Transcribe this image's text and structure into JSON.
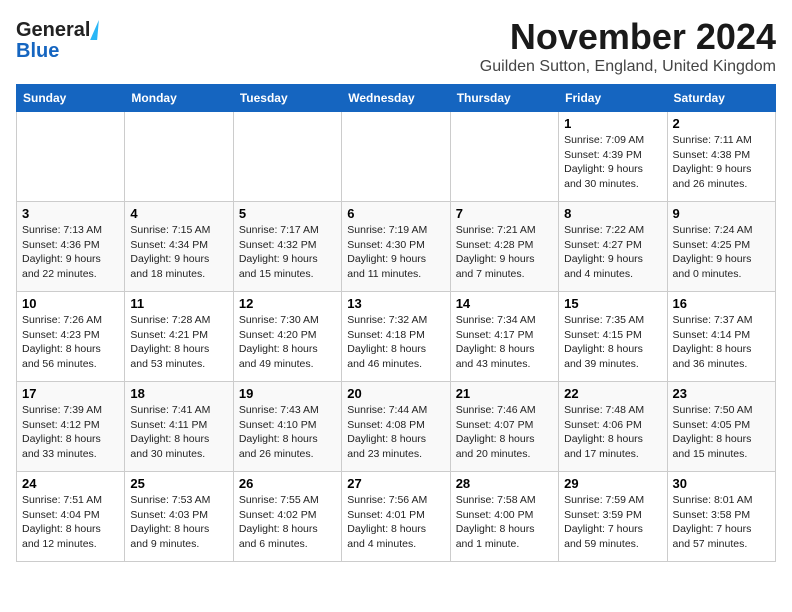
{
  "header": {
    "logo_general": "General",
    "logo_blue": "Blue",
    "month_title": "November 2024",
    "location": "Guilden Sutton, England, United Kingdom"
  },
  "calendar": {
    "days_of_week": [
      "Sunday",
      "Monday",
      "Tuesday",
      "Wednesday",
      "Thursday",
      "Friday",
      "Saturday"
    ],
    "weeks": [
      [
        {
          "day": "",
          "info": ""
        },
        {
          "day": "",
          "info": ""
        },
        {
          "day": "",
          "info": ""
        },
        {
          "day": "",
          "info": ""
        },
        {
          "day": "",
          "info": ""
        },
        {
          "day": "1",
          "info": "Sunrise: 7:09 AM\nSunset: 4:39 PM\nDaylight: 9 hours and 30 minutes."
        },
        {
          "day": "2",
          "info": "Sunrise: 7:11 AM\nSunset: 4:38 PM\nDaylight: 9 hours and 26 minutes."
        }
      ],
      [
        {
          "day": "3",
          "info": "Sunrise: 7:13 AM\nSunset: 4:36 PM\nDaylight: 9 hours and 22 minutes."
        },
        {
          "day": "4",
          "info": "Sunrise: 7:15 AM\nSunset: 4:34 PM\nDaylight: 9 hours and 18 minutes."
        },
        {
          "day": "5",
          "info": "Sunrise: 7:17 AM\nSunset: 4:32 PM\nDaylight: 9 hours and 15 minutes."
        },
        {
          "day": "6",
          "info": "Sunrise: 7:19 AM\nSunset: 4:30 PM\nDaylight: 9 hours and 11 minutes."
        },
        {
          "day": "7",
          "info": "Sunrise: 7:21 AM\nSunset: 4:28 PM\nDaylight: 9 hours and 7 minutes."
        },
        {
          "day": "8",
          "info": "Sunrise: 7:22 AM\nSunset: 4:27 PM\nDaylight: 9 hours and 4 minutes."
        },
        {
          "day": "9",
          "info": "Sunrise: 7:24 AM\nSunset: 4:25 PM\nDaylight: 9 hours and 0 minutes."
        }
      ],
      [
        {
          "day": "10",
          "info": "Sunrise: 7:26 AM\nSunset: 4:23 PM\nDaylight: 8 hours and 56 minutes."
        },
        {
          "day": "11",
          "info": "Sunrise: 7:28 AM\nSunset: 4:21 PM\nDaylight: 8 hours and 53 minutes."
        },
        {
          "day": "12",
          "info": "Sunrise: 7:30 AM\nSunset: 4:20 PM\nDaylight: 8 hours and 49 minutes."
        },
        {
          "day": "13",
          "info": "Sunrise: 7:32 AM\nSunset: 4:18 PM\nDaylight: 8 hours and 46 minutes."
        },
        {
          "day": "14",
          "info": "Sunrise: 7:34 AM\nSunset: 4:17 PM\nDaylight: 8 hours and 43 minutes."
        },
        {
          "day": "15",
          "info": "Sunrise: 7:35 AM\nSunset: 4:15 PM\nDaylight: 8 hours and 39 minutes."
        },
        {
          "day": "16",
          "info": "Sunrise: 7:37 AM\nSunset: 4:14 PM\nDaylight: 8 hours and 36 minutes."
        }
      ],
      [
        {
          "day": "17",
          "info": "Sunrise: 7:39 AM\nSunset: 4:12 PM\nDaylight: 8 hours and 33 minutes."
        },
        {
          "day": "18",
          "info": "Sunrise: 7:41 AM\nSunset: 4:11 PM\nDaylight: 8 hours and 30 minutes."
        },
        {
          "day": "19",
          "info": "Sunrise: 7:43 AM\nSunset: 4:10 PM\nDaylight: 8 hours and 26 minutes."
        },
        {
          "day": "20",
          "info": "Sunrise: 7:44 AM\nSunset: 4:08 PM\nDaylight: 8 hours and 23 minutes."
        },
        {
          "day": "21",
          "info": "Sunrise: 7:46 AM\nSunset: 4:07 PM\nDaylight: 8 hours and 20 minutes."
        },
        {
          "day": "22",
          "info": "Sunrise: 7:48 AM\nSunset: 4:06 PM\nDaylight: 8 hours and 17 minutes."
        },
        {
          "day": "23",
          "info": "Sunrise: 7:50 AM\nSunset: 4:05 PM\nDaylight: 8 hours and 15 minutes."
        }
      ],
      [
        {
          "day": "24",
          "info": "Sunrise: 7:51 AM\nSunset: 4:04 PM\nDaylight: 8 hours and 12 minutes."
        },
        {
          "day": "25",
          "info": "Sunrise: 7:53 AM\nSunset: 4:03 PM\nDaylight: 8 hours and 9 minutes."
        },
        {
          "day": "26",
          "info": "Sunrise: 7:55 AM\nSunset: 4:02 PM\nDaylight: 8 hours and 6 minutes."
        },
        {
          "day": "27",
          "info": "Sunrise: 7:56 AM\nSunset: 4:01 PM\nDaylight: 8 hours and 4 minutes."
        },
        {
          "day": "28",
          "info": "Sunrise: 7:58 AM\nSunset: 4:00 PM\nDaylight: 8 hours and 1 minute."
        },
        {
          "day": "29",
          "info": "Sunrise: 7:59 AM\nSunset: 3:59 PM\nDaylight: 7 hours and 59 minutes."
        },
        {
          "day": "30",
          "info": "Sunrise: 8:01 AM\nSunset: 3:58 PM\nDaylight: 7 hours and 57 minutes."
        }
      ]
    ]
  }
}
